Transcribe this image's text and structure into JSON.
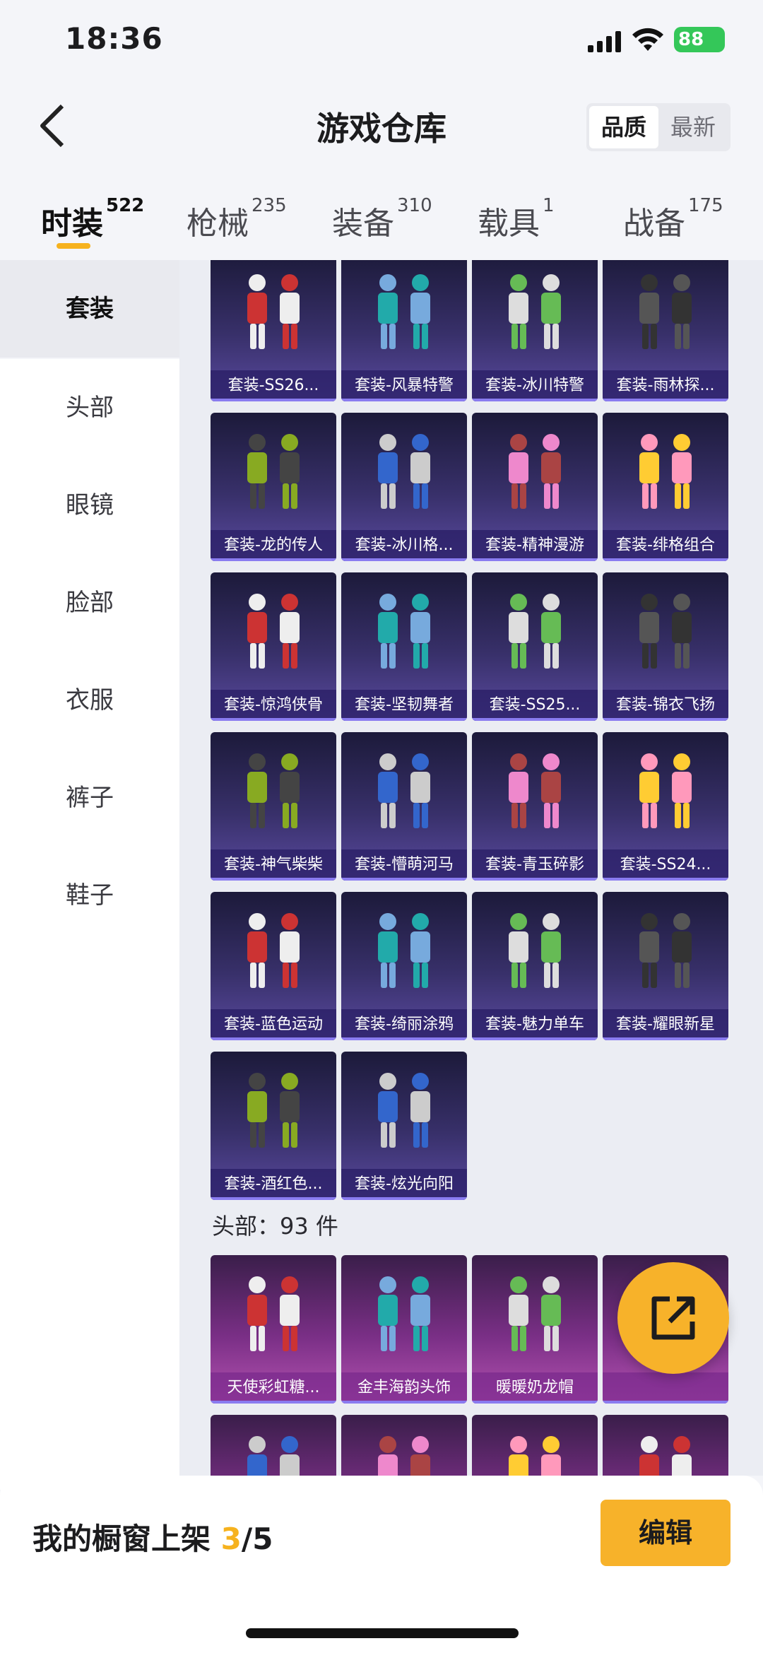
{
  "status": {
    "time": "18:36",
    "battery": "88"
  },
  "header": {
    "title": "游戏仓库",
    "sort_options": [
      "品质",
      "最新"
    ]
  },
  "tabs": [
    {
      "label": "时装",
      "count": "522"
    },
    {
      "label": "枪械",
      "count": "235"
    },
    {
      "label": "装备",
      "count": "310"
    },
    {
      "label": "载具",
      "count": "1"
    },
    {
      "label": "战备",
      "count": "175"
    }
  ],
  "sidebar": {
    "items": [
      "套装",
      "头部",
      "眼镜",
      "脸部",
      "衣服",
      "裤子",
      "鞋子"
    ]
  },
  "suits": [
    "套装-SS26...",
    "套装-风暴特警",
    "套装-冰川特警",
    "套装-雨林探...",
    "套装-龙的传人",
    "套装-冰川格...",
    "套装-精神漫游",
    "套装-绯格组合",
    "套装-惊鸿侠骨",
    "套装-坚韧舞者",
    "套装-SS25...",
    "套装-锦衣飞扬",
    "套装-神气柴柴",
    "套装-懵萌河马",
    "套装-青玉碎影",
    "套装-SS24...",
    "套装-蓝色运动",
    "套装-绮丽涂鸦",
    "套装-魅力单车",
    "套装-耀眼新星",
    "套装-酒红色...",
    "套装-炫光向阳"
  ],
  "head_section": {
    "title": "头部：93 件"
  },
  "heads": [
    "天使彩虹糖...",
    "金丰海韵头饰",
    "暖暖奶龙帽",
    ""
  ],
  "bottom": {
    "shelf_label": "我的橱窗上架",
    "shelf_current": "3",
    "shelf_total": "/5",
    "edit_label": "编辑"
  },
  "colors": {
    "accent": "#f6b21e",
    "card_purple": "#38306a",
    "card_pink": "#7a2f86"
  }
}
